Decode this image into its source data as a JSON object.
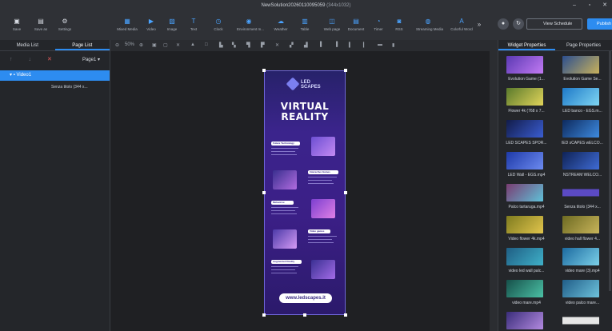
{
  "window": {
    "title": "NewSolution20260110095059",
    "title_dim": "(344x1032)",
    "min": "–",
    "restore": "▫",
    "close": "✕"
  },
  "toolbar": {
    "left": [
      {
        "label": "Save",
        "icon": "save-icon"
      },
      {
        "label": "Save as",
        "icon": "save-as-icon"
      },
      {
        "label": "Settings",
        "icon": "gear-icon"
      }
    ],
    "widgets": [
      {
        "label": "Mixed Media",
        "icon": "mixed-media-icon"
      },
      {
        "label": "Video",
        "icon": "video-icon"
      },
      {
        "label": "Image",
        "icon": "image-icon"
      },
      {
        "label": "Text",
        "icon": "text-icon"
      },
      {
        "label": "Clock",
        "icon": "clock-icon"
      },
      {
        "label": "Environment m...",
        "icon": "environment-icon"
      },
      {
        "label": "Weather",
        "icon": "weather-icon"
      },
      {
        "label": "Table",
        "icon": "table-icon"
      },
      {
        "label": "Web page",
        "icon": "web-page-icon"
      },
      {
        "label": "Document",
        "icon": "document-icon"
      },
      {
        "label": "Timer",
        "icon": "timer-icon"
      },
      {
        "label": "RSS",
        "icon": "rss-icon"
      },
      {
        "label": "Streaming Media",
        "icon": "streaming-icon"
      },
      {
        "label": "Colorful Word",
        "icon": "colorful-word-icon"
      }
    ],
    "more": "»",
    "view_schedule": "View Schedule",
    "publish": "Publish"
  },
  "left_panel": {
    "tabs": [
      "Media List",
      "Page List"
    ],
    "page_select": "Page1",
    "items": [
      {
        "label": "Video1"
      },
      {
        "label": "Senza titolo (344 x..."
      }
    ]
  },
  "canvas": {
    "zoom": "50%",
    "ad": {
      "logo_line1": "LED",
      "logo_line2": "SCAPES",
      "title_line1": "VIRTUAL",
      "title_line2": "REALITY",
      "section1": "Future Technology",
      "section2": "Interactive Games",
      "section3": "Metaverse",
      "section4": "Video games",
      "section5": "Augmented Reality",
      "url": "www.ledscapes.it"
    }
  },
  "right_panel": {
    "tabs": [
      "Widget Properties",
      "Page Properties"
    ],
    "items": [
      {
        "name": "Evolution Game (1..."
      },
      {
        "name": "Evolution Game Se..."
      },
      {
        "name": "Flower 4k (768 x 7..."
      },
      {
        "name": "LED banco - EGS.m..."
      },
      {
        "name": "LED SCAPES SPOR..."
      },
      {
        "name": "lED sCAPES wELCO..."
      },
      {
        "name": "LED Wall - EGS.mp4"
      },
      {
        "name": "NSTREAM WELCO..."
      },
      {
        "name": "Palco tartaruga.mp4"
      },
      {
        "name": "Senza titolo (344 x..."
      },
      {
        "name": "Video flower 4k.mp4"
      },
      {
        "name": "video hall flower 4..."
      },
      {
        "name": "video led wall palc..."
      },
      {
        "name": "video mare (3).mp4"
      },
      {
        "name": "video mare.mp4"
      },
      {
        "name": "video palco mare..."
      }
    ]
  },
  "colors": {
    "accent": "#2d8cf0",
    "background": "#2b2d31"
  }
}
